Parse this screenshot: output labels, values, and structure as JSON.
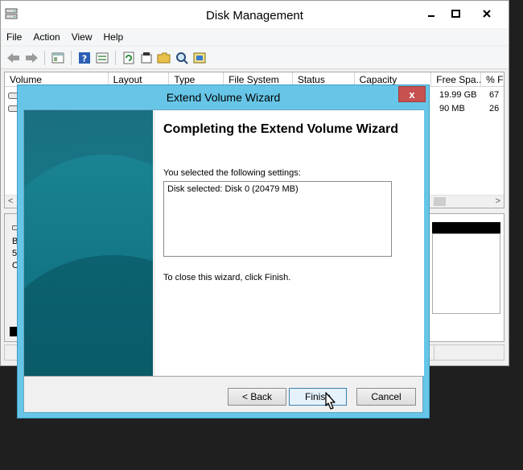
{
  "main_window": {
    "title": "Disk Management",
    "window_buttons": {
      "minimize": "–",
      "maximize": "□",
      "close": "✕"
    },
    "menu": [
      "File",
      "Action",
      "View",
      "Help"
    ],
    "toolbar_icons": [
      "back-arrow-icon",
      "forward-arrow-icon",
      "properties-icon",
      "help-icon",
      "list-view-icon",
      "refresh-icon",
      "settings-icon",
      "open-folder-icon",
      "search-icon",
      "rescan-icon"
    ],
    "columns": [
      "Volume",
      "Layout",
      "Type",
      "File System",
      "Status",
      "Capacity",
      "Free Spa...",
      "% F"
    ],
    "volumes": [
      {
        "free_space": "19.99 GB",
        "percent_free": "67"
      },
      {
        "free_space": "90 MB",
        "percent_free": "26"
      }
    ],
    "disk_labels": [
      "B",
      "5",
      "O"
    ],
    "scroll_left": "<",
    "scroll_right": ">"
  },
  "wizard": {
    "title": "Extend Volume Wizard",
    "close_label": "x",
    "heading": "Completing the Extend Volume Wizard",
    "settings_label": "You selected the following settings:",
    "settings_text": "Disk selected: Disk 0 (20479 MB)",
    "close_instruction": "To close this wizard, click Finish.",
    "buttons": {
      "back": "< Back",
      "finish": "Finish",
      "cancel": "Cancel"
    }
  },
  "colors": {
    "wizard_frame": "#67c6e8",
    "close_button": "#c75050",
    "banner": "#167887"
  }
}
